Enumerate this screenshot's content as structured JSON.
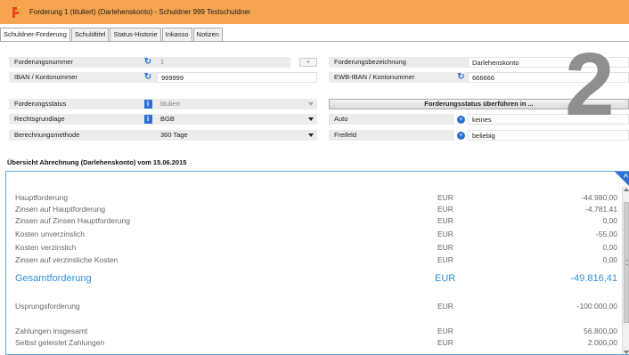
{
  "window": {
    "title": "Forderung 1 (tituliert) (Darlehenskonto)  -  Schuldner 999 Testschuldner",
    "accent_color": "#f5a550",
    "logo_icon": "app-logo-icon"
  },
  "tabs": [
    {
      "label": "Schuldner-Forderung",
      "active": true
    },
    {
      "label": "Schuldtitel",
      "active": false
    },
    {
      "label": "Status-Historie",
      "active": false
    },
    {
      "label": "Inkasso",
      "active": false
    },
    {
      "label": "Notizen",
      "active": false
    }
  ],
  "form": {
    "forderungsnummer": {
      "label": "Forderungsnummer",
      "value": "1",
      "icon": "refresh-icon",
      "plus": "+"
    },
    "iban": {
      "label": "IBAN / Kontonummer",
      "value": "999999",
      "icon": "refresh-icon"
    },
    "forderungsstatus": {
      "label": "Forderungsstatus",
      "value": "tituliert",
      "icon": "info-icon"
    },
    "rechtsgrundlage": {
      "label": "Rechtsgrundlage",
      "value": "BGB",
      "icon": "info-icon"
    },
    "berechnungsmethode": {
      "label": "Berechnungsmethode",
      "value": "360 Tage"
    },
    "forderungsbezeichnung": {
      "label": "Forderungsbezeichnung",
      "value": "Darlehenskonto"
    },
    "ewb_iban": {
      "label": "EWB-IBAN / Kontonummer",
      "value": "666666",
      "icon": "refresh-icon"
    },
    "status_button": "Forderungsstatus überführen in ...",
    "auto": {
      "label": "Auto",
      "value": "keines",
      "icon": "dot-icon"
    },
    "freifeld": {
      "label": "Freifeld",
      "value": "beliebig",
      "icon": "dot-icon"
    }
  },
  "overlay_number": "2",
  "overview": {
    "title": "Übersicht Abrechnung (Darlehenskonto) vom 15.06.2015",
    "rows": [
      {
        "label": "Hauptforderung",
        "currency": "EUR",
        "value": "-44.980,00"
      },
      {
        "label": "Zinsen auf Hauptforderung",
        "currency": "EUR",
        "value": "-4.781,41"
      },
      {
        "label": "Zinsen auf Zinsen Hauptforderung",
        "currency": "EUR",
        "value": "0,00"
      },
      {
        "label": "Kosten unverzinslich",
        "currency": "EUR",
        "value": "-55,00"
      },
      {
        "label": "Kosten verzinslich",
        "currency": "EUR",
        "value": "0,00"
      },
      {
        "label": "Zinsen auf verzinsliche Kosten",
        "currency": "EUR",
        "value": "0,00"
      }
    ],
    "total": {
      "label": "Gesamtforderung",
      "currency": "EUR",
      "value": "-49.816,41"
    },
    "ursprung": {
      "label": "Usprungsforderung",
      "currency": "EUR",
      "value": "-100.000,00"
    },
    "zahlungen": {
      "label": "Zahlungen insgesamt",
      "currency": "EUR",
      "value": "56.800,00"
    },
    "selbst": {
      "label": "Selbst geleistet Zahlungen",
      "currency": "EUR",
      "value": "2.000,00"
    },
    "highlight_color": "#2e8fdc"
  }
}
